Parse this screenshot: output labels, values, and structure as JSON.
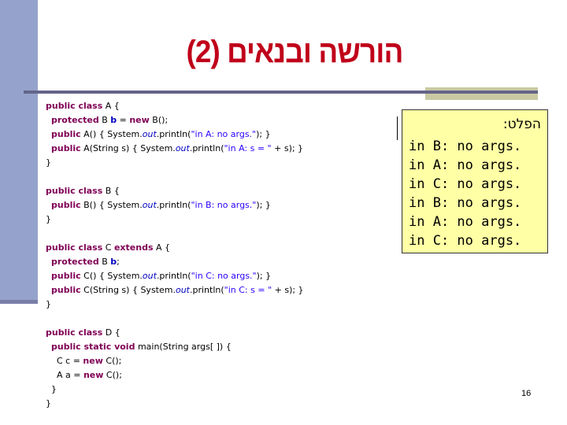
{
  "slide": {
    "title": "הורשה ובנאים (2)",
    "page_number": "16",
    "colors": {
      "title": "#c0001a",
      "sidebar": "#95a3cc",
      "divider": "#646489",
      "accent_box": "#c9c9a3",
      "keyword": "#7f0055",
      "string": "#2a00ff",
      "field": "#0000c0",
      "output_bg": "#ffffa6"
    }
  },
  "code": {
    "lines": [
      [
        {
          "t": "kw",
          "v": "public class"
        },
        {
          "t": "",
          "v": " A {"
        }
      ],
      [
        {
          "t": "",
          "v": "  "
        },
        {
          "t": "kw",
          "v": "protected"
        },
        {
          "t": "",
          "v": " B "
        },
        {
          "t": "fld",
          "v": "b"
        },
        {
          "t": "",
          "v": " = "
        },
        {
          "t": "kw",
          "v": "new"
        },
        {
          "t": "",
          "v": " B();"
        }
      ],
      [
        {
          "t": "",
          "v": "  "
        },
        {
          "t": "kw",
          "v": "public"
        },
        {
          "t": "",
          "v": " A() { System."
        },
        {
          "t": "st",
          "v": "out"
        },
        {
          "t": "",
          "v": ".println("
        },
        {
          "t": "str",
          "v": "\"in A: no args.\""
        },
        {
          "t": "",
          "v": "); }"
        }
      ],
      [
        {
          "t": "",
          "v": "  "
        },
        {
          "t": "kw",
          "v": "public"
        },
        {
          "t": "",
          "v": " A(String s) { System."
        },
        {
          "t": "st",
          "v": "out"
        },
        {
          "t": "",
          "v": ".println("
        },
        {
          "t": "str",
          "v": "\"in A: s = \""
        },
        {
          "t": "",
          "v": " + s); }"
        }
      ],
      [
        {
          "t": "",
          "v": "}"
        }
      ],
      [
        {
          "t": "",
          "v": ""
        }
      ],
      [
        {
          "t": "kw",
          "v": "public class"
        },
        {
          "t": "",
          "v": " B {"
        }
      ],
      [
        {
          "t": "",
          "v": "  "
        },
        {
          "t": "kw",
          "v": "public"
        },
        {
          "t": "",
          "v": " B() { System."
        },
        {
          "t": "st",
          "v": "out"
        },
        {
          "t": "",
          "v": ".println("
        },
        {
          "t": "str",
          "v": "\"in B: no args.\""
        },
        {
          "t": "",
          "v": "); }"
        }
      ],
      [
        {
          "t": "",
          "v": "}"
        }
      ],
      [
        {
          "t": "",
          "v": ""
        }
      ],
      [
        {
          "t": "kw",
          "v": "public class"
        },
        {
          "t": "",
          "v": " C "
        },
        {
          "t": "kw",
          "v": "extends"
        },
        {
          "t": "",
          "v": " A {"
        }
      ],
      [
        {
          "t": "",
          "v": "  "
        },
        {
          "t": "kw",
          "v": "protected"
        },
        {
          "t": "",
          "v": " B "
        },
        {
          "t": "fld",
          "v": "b"
        },
        {
          "t": "",
          "v": ";"
        }
      ],
      [
        {
          "t": "",
          "v": "  "
        },
        {
          "t": "kw",
          "v": "public"
        },
        {
          "t": "",
          "v": " C() { System."
        },
        {
          "t": "st",
          "v": "out"
        },
        {
          "t": "",
          "v": ".println("
        },
        {
          "t": "str",
          "v": "\"in C: no args.\""
        },
        {
          "t": "",
          "v": "); }"
        }
      ],
      [
        {
          "t": "",
          "v": "  "
        },
        {
          "t": "kw",
          "v": "public"
        },
        {
          "t": "",
          "v": " C(String s) { System."
        },
        {
          "t": "st",
          "v": "out"
        },
        {
          "t": "",
          "v": ".println("
        },
        {
          "t": "str",
          "v": "\"in C: s = \""
        },
        {
          "t": "",
          "v": " + s); }"
        }
      ],
      [
        {
          "t": "",
          "v": "}"
        }
      ],
      [
        {
          "t": "",
          "v": ""
        }
      ],
      [
        {
          "t": "kw",
          "v": "public class"
        },
        {
          "t": "",
          "v": " D {"
        }
      ],
      [
        {
          "t": "",
          "v": "  "
        },
        {
          "t": "kw",
          "v": "public static void"
        },
        {
          "t": "",
          "v": " main(String args[ ]) {"
        }
      ],
      [
        {
          "t": "",
          "v": "    C c = "
        },
        {
          "t": "kw",
          "v": "new"
        },
        {
          "t": "",
          "v": " C();"
        }
      ],
      [
        {
          "t": "",
          "v": "    A a = "
        },
        {
          "t": "kw",
          "v": "new"
        },
        {
          "t": "",
          "v": " C();"
        }
      ],
      [
        {
          "t": "",
          "v": "  }"
        }
      ],
      [
        {
          "t": "",
          "v": "}"
        }
      ]
    ]
  },
  "output": {
    "header": "הפלט:",
    "lines": [
      "in B: no args.",
      "in A: no args.",
      "in C: no args.",
      "in B: no args.",
      "in A: no args.",
      "in C: no args."
    ]
  }
}
